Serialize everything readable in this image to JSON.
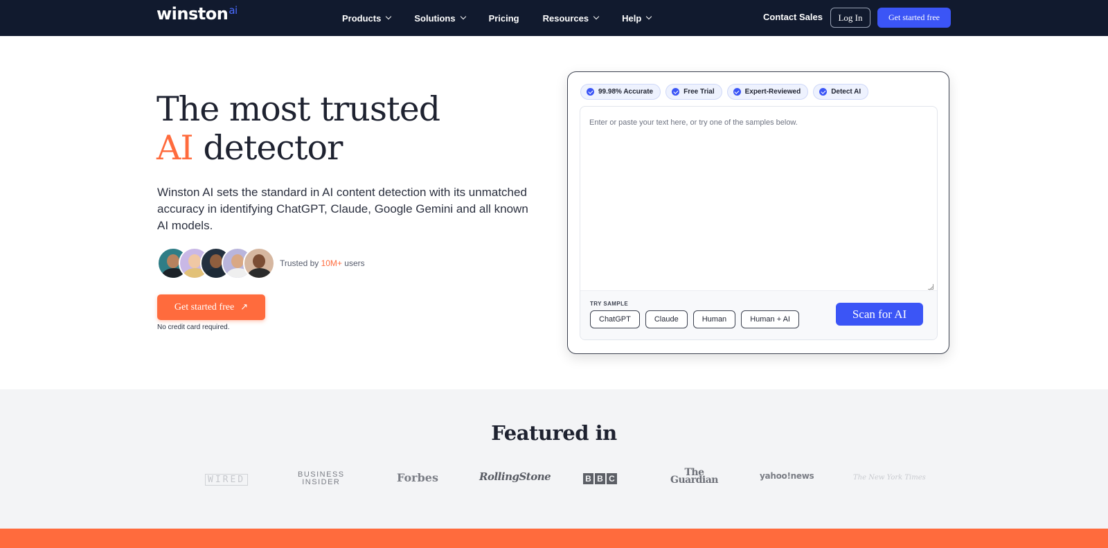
{
  "nav": {
    "logo_text": "winston",
    "logo_suffix": "ai",
    "menu": [
      {
        "label": "Products",
        "has_dropdown": true
      },
      {
        "label": "Solutions",
        "has_dropdown": true
      },
      {
        "label": "Pricing",
        "has_dropdown": false
      },
      {
        "label": "Resources",
        "has_dropdown": true
      },
      {
        "label": "Help",
        "has_dropdown": true
      }
    ],
    "contact_label": "Contact Sales",
    "login_label": "Log In",
    "cta_label": "Get started free"
  },
  "hero": {
    "title_line1": "The most trusted",
    "title_highlight": "AI",
    "title_line2_rest": " detector",
    "description": "Winston AI sets the standard in AI content detection with its unmatched accuracy in identifying ChatGPT, Claude, Google Gemini and all known AI models.",
    "trusted_prefix": "Trusted by ",
    "trusted_count": "10M+",
    "trusted_suffix": " users",
    "cta_label": "Get started free",
    "cta_arrow": "↗",
    "note": "No credit card required."
  },
  "detector": {
    "badges": [
      "99.98% Accurate",
      "Free Trial",
      "Expert-Reviewed",
      "Detect AI"
    ],
    "input_value": "",
    "placeholder": "Enter or paste your text here, or try one of the samples below.",
    "try_sample_label": "TRY SAMPLE",
    "samples": [
      "ChatGPT",
      "Claude",
      "Human",
      "Human + AI"
    ],
    "scan_label": "Scan for AI"
  },
  "featured": {
    "title": "Featured in",
    "logos": {
      "wired": "WIRED",
      "business_insider_1": "BUSINESS",
      "business_insider_2": "INSIDER",
      "forbes": "Forbes",
      "rolling_stone": "RollingStone",
      "bbc": [
        "B",
        "B",
        "C"
      ],
      "guardian_1": "The",
      "guardian_2": "Guardian",
      "yahoo": "yahoo!news",
      "nyt": "The New York Times"
    }
  },
  "colors": {
    "nav_bg": "#111a2e",
    "primary_blue": "#3b55f6",
    "accent_orange": "#ff6b3d",
    "featured_bg": "#f3f4f6"
  }
}
